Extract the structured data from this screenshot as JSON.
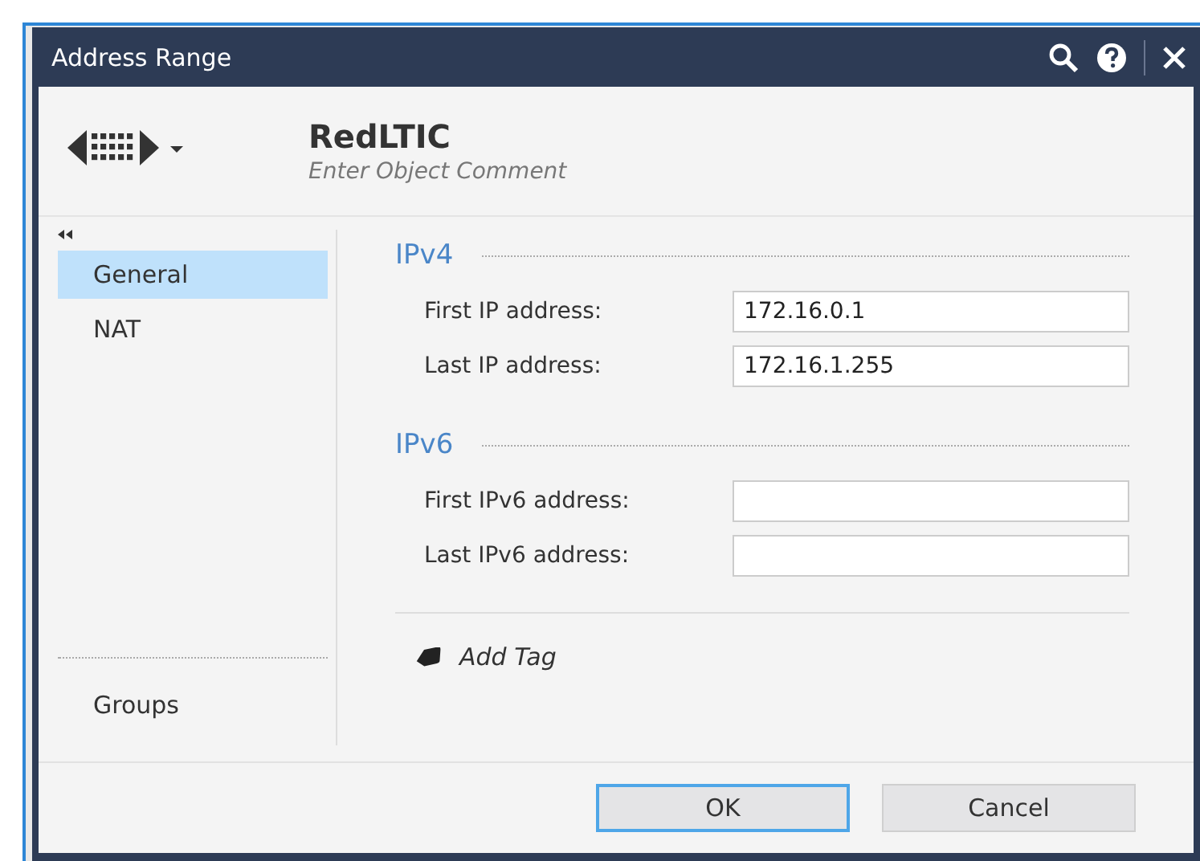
{
  "window": {
    "title": "Address Range"
  },
  "header": {
    "name": "RedLTIC",
    "comment_placeholder": "Enter Object Comment"
  },
  "sidebar": {
    "items": [
      {
        "label": "General",
        "selected": true
      },
      {
        "label": "NAT",
        "selected": false
      }
    ],
    "bottom_items": [
      {
        "label": "Groups",
        "selected": false
      }
    ]
  },
  "sections": [
    {
      "title": "IPv4",
      "fields": [
        {
          "label": "First IP address:",
          "value": "172.16.0.1"
        },
        {
          "label": "Last IP address:",
          "value": "172.16.1.255"
        }
      ]
    },
    {
      "title": "IPv6",
      "fields": [
        {
          "label": "First IPv6 address:"
        },
        {
          "label": "Last IPv6 address:"
        }
      ]
    }
  ],
  "add_tag": "Add Tag",
  "buttons": [
    {
      "label": "OK",
      "default": true
    },
    {
      "label": "Cancel",
      "default": false
    }
  ]
}
